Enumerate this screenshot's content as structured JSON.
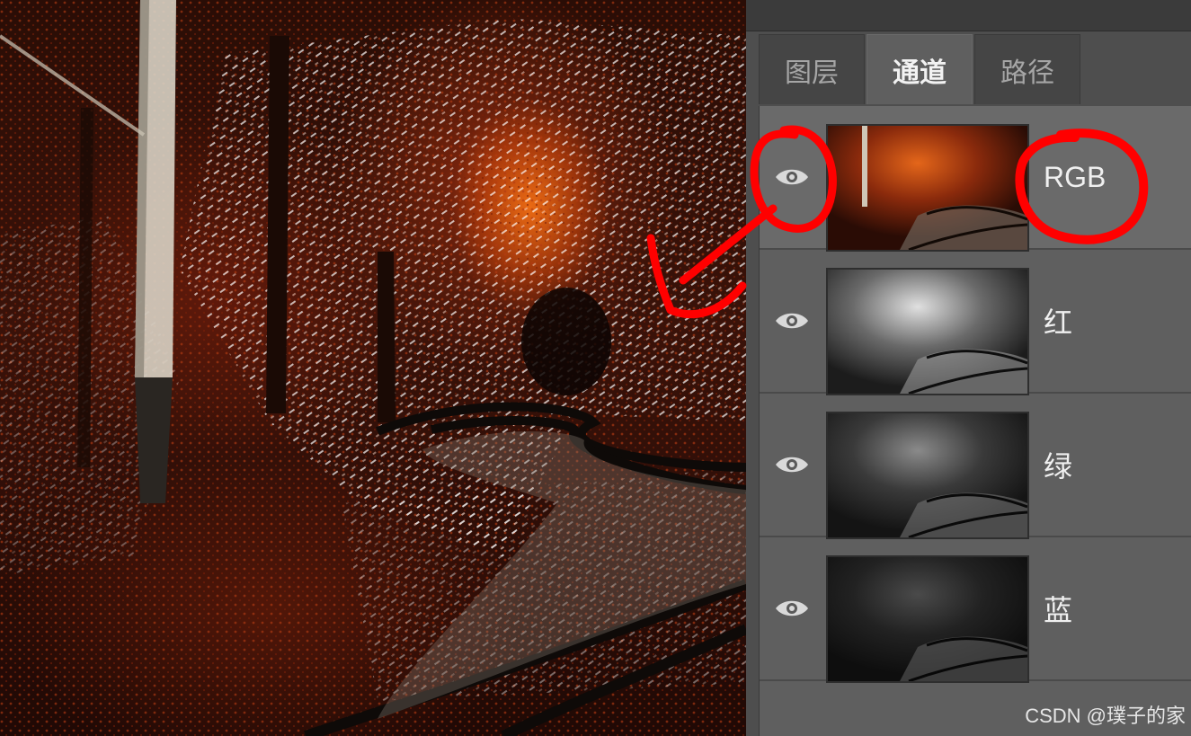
{
  "channels_panel": {
    "tabs": [
      {
        "label": "图层",
        "active": false
      },
      {
        "label": "通道",
        "active": true
      },
      {
        "label": "路径",
        "active": false
      }
    ],
    "channels": [
      {
        "name": "RGB",
        "visible": true,
        "selected": true,
        "thumb_style": "color"
      },
      {
        "name": "红",
        "visible": true,
        "selected": false,
        "thumb_style": "gray-bright"
      },
      {
        "name": "绿",
        "visible": true,
        "selected": false,
        "thumb_style": "gray-mid"
      },
      {
        "name": "蓝",
        "visible": true,
        "selected": false,
        "thumb_style": "gray-dark"
      }
    ]
  },
  "watermark": "CSDN @璞子的家",
  "annotation": {
    "color": "#ff0000",
    "highlights": [
      "rgb-eye-icon",
      "rgb-channel-label"
    ]
  },
  "icons": {
    "visibility": "eye-icon"
  }
}
